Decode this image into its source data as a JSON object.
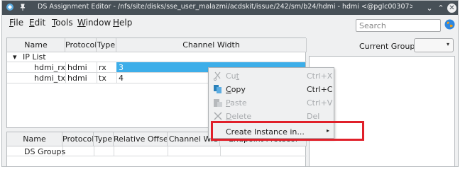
{
  "titlebar": {
    "title": "DS Assignment Editor - /nfs/site/disks/sse_user_malazmi/acdskit/issue/242/sm/b24/hdmi - hdmi <@pglc00307>",
    "minimize_glyph": "⌄",
    "maximize_glyph": "⌃",
    "close_glyph": "✕"
  },
  "menubar": {
    "items": [
      {
        "mnemonic": "F",
        "rest": "ile"
      },
      {
        "mnemonic": "E",
        "rest": "dit"
      },
      {
        "mnemonic": "T",
        "rest": "ools"
      },
      {
        "mnemonic": "W",
        "rest": "indow"
      },
      {
        "mnemonic": "H",
        "rest": "elp"
      }
    ],
    "search_placeholder": "Search"
  },
  "ip_table": {
    "columns": [
      "Name",
      "Protocol",
      "Type",
      "Channel Width"
    ],
    "group_toggle": "▾",
    "group_label": "IP List",
    "rows": [
      {
        "name": "hdmi_rx",
        "protocol": "hdmi",
        "type": "rx",
        "width": "3"
      },
      {
        "name": "hdmi_tx",
        "protocol": "hdmi",
        "type": "tx",
        "width": "4"
      }
    ]
  },
  "ds_table": {
    "columns": [
      "Name",
      "Protocol",
      "Type",
      "Relative Offset",
      "Channel Wid",
      "Endpoint Protocol"
    ],
    "rows": [
      {
        "name": "DS Groups"
      }
    ]
  },
  "current_group": {
    "label": "Current Group:",
    "value": "",
    "arrow": "▾"
  },
  "context_menu": {
    "items": [
      {
        "label": "Cut",
        "mnemonic_index": 2,
        "shortcut": "Ctrl+X",
        "enabled": false,
        "icon": "cut-icon"
      },
      {
        "label": "Copy",
        "mnemonic_index": 0,
        "shortcut": "Ctrl+C",
        "enabled": true,
        "icon": "copy-icon"
      },
      {
        "label": "Paste",
        "mnemonic_index": 0,
        "shortcut": "Ctrl+V",
        "enabled": false,
        "icon": "paste-icon"
      },
      {
        "label": "Delete",
        "mnemonic_index": 0,
        "shortcut": "Del",
        "enabled": false,
        "icon": "delete-icon"
      },
      {
        "label": "Create Instance in...",
        "shortcut": "",
        "enabled": true,
        "submenu": "▸"
      }
    ]
  },
  "colors": {
    "titlebar_bg": "#475057",
    "selection": "#3daee9",
    "highlight_border": "#e0202a",
    "copy_icon": "#2980b9"
  }
}
